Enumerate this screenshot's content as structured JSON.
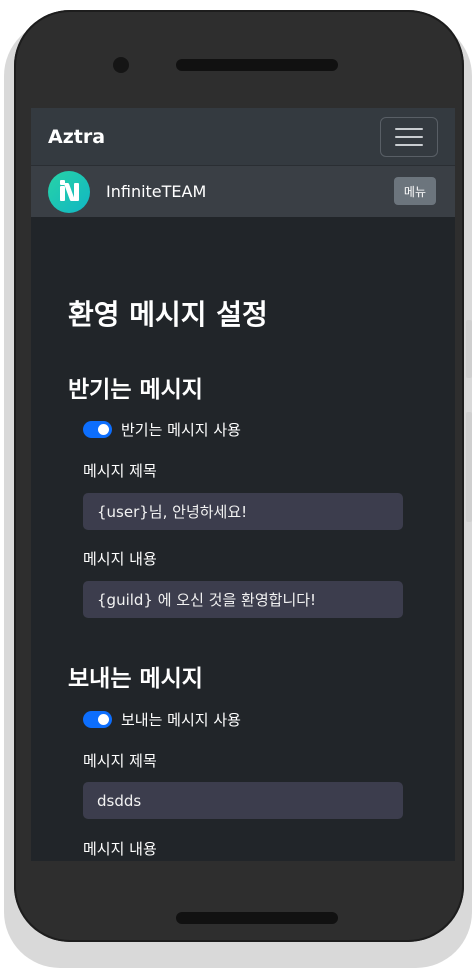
{
  "navbar": {
    "brand": "Aztra"
  },
  "server": {
    "name": "InfiniteTEAM",
    "menu_label": "메뉴"
  },
  "page": {
    "title": "환영 메시지 설정"
  },
  "welcome": {
    "section_title": "반기는 메시지",
    "toggle_label": "반기는 메시지 사용",
    "toggle_on": true,
    "title_label": "메시지 제목",
    "title_value": "{user}님, 안녕하세요!",
    "content_label": "메시지 내용",
    "content_value": "{guild} 에 오신 것을 환영합니다!"
  },
  "farewell": {
    "section_title": "보내는 메시지",
    "toggle_label": "보내는 메시지 사용",
    "toggle_on": true,
    "title_label": "메시지 제목",
    "title_value": "dsdds",
    "content_label": "메시지 내용"
  },
  "colors": {
    "accent": "#0d6efd",
    "background": "#212529",
    "navbar": "#343a40",
    "input": "#3c3d4d"
  }
}
